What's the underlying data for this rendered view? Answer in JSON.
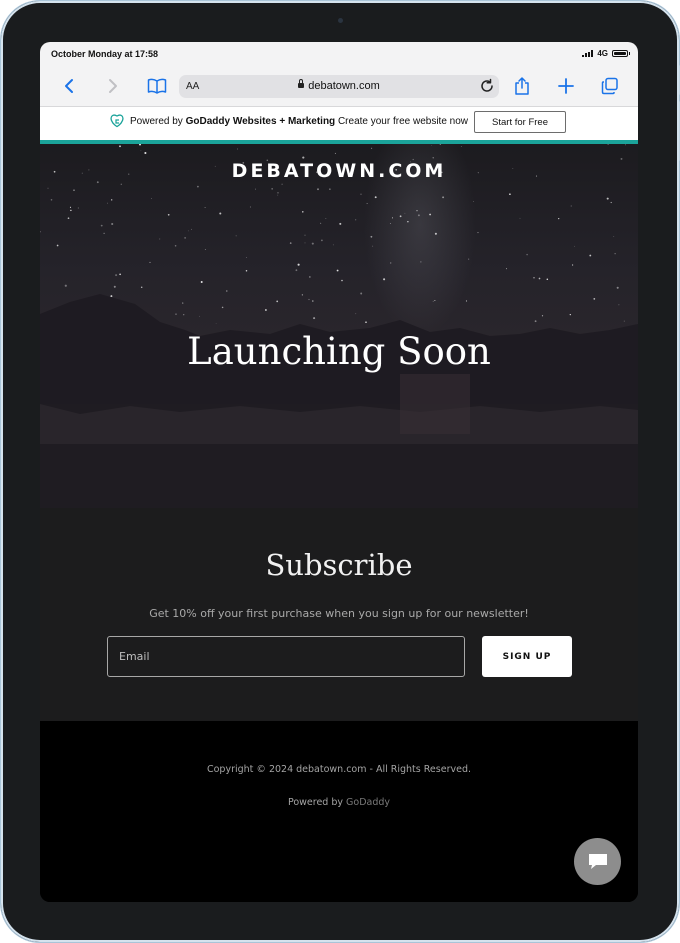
{
  "status_bar": {
    "time": "October Monday at 17:58",
    "network": "4G"
  },
  "browser": {
    "aa_label": "AA",
    "url": "debatown.com"
  },
  "banner": {
    "powered_prefix": "Powered by",
    "brand": "GoDaddy Websites + Marketing",
    "tagline": "Create your free website now",
    "cta": "Start for Free"
  },
  "hero": {
    "site_name": "DEBATOWN.COM",
    "title": "Launching Soon"
  },
  "subscribe": {
    "title": "Subscribe",
    "text": "Get 10% off your first purchase when you sign up for our newsletter!",
    "email_placeholder": "Email",
    "button": "SIGN UP"
  },
  "footer": {
    "copyright": "Copyright © 2024 debatown.com - All Rights Reserved.",
    "powered_prefix": "Powered by",
    "powered_link": "GoDaddy"
  },
  "colors": {
    "accent_bar": "#1ba39a",
    "ios_blue": "#1a73e8"
  }
}
